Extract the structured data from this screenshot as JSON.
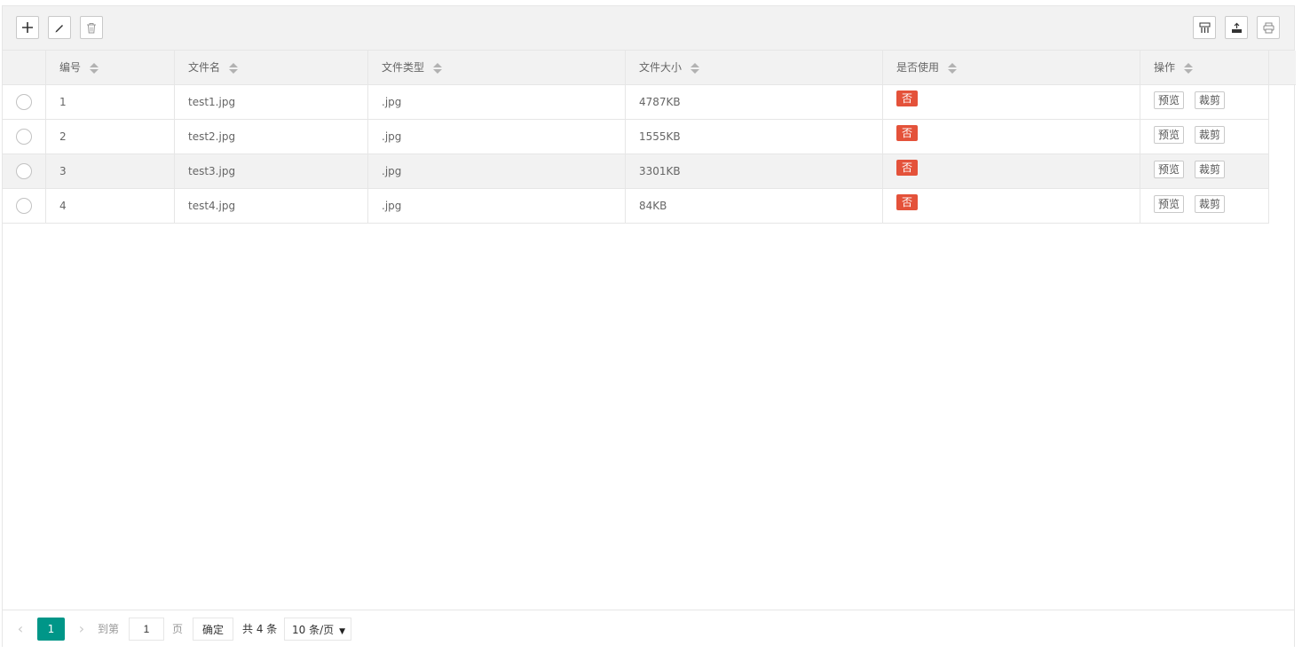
{
  "toolbar": {
    "left": [
      "add-icon",
      "edit-icon",
      "delete-icon"
    ],
    "right": [
      "columns-icon",
      "export-icon",
      "print-icon"
    ]
  },
  "table": {
    "columns": [
      "编号",
      "文件名",
      "文件类型",
      "文件大小",
      "是否使用",
      "操作"
    ],
    "rows": [
      {
        "id": "1",
        "name": "test1.jpg",
        "type": ".jpg",
        "size": "4787KB",
        "used": "否"
      },
      {
        "id": "2",
        "name": "test2.jpg",
        "type": ".jpg",
        "size": "1555KB",
        "used": "否"
      },
      {
        "id": "3",
        "name": "test3.jpg",
        "type": ".jpg",
        "size": "3301KB",
        "used": "否"
      },
      {
        "id": "4",
        "name": "test4.jpg",
        "type": ".jpg",
        "size": "84KB",
        "used": "否"
      }
    ],
    "actions": {
      "preview": "预览",
      "crop": "裁剪"
    }
  },
  "pagination": {
    "current": "1",
    "goto_label": "到第",
    "goto_value": "1",
    "page_label": "页",
    "confirm": "确定",
    "total": "共 4 条",
    "page_size": "10 条/页"
  },
  "colors": {
    "accent": "#009688",
    "badge": "#e4523a"
  }
}
